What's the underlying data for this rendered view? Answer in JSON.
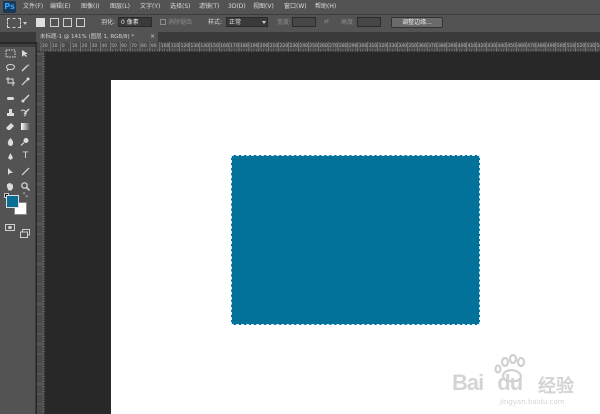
{
  "app": {
    "logo": "Ps"
  },
  "menu": [
    {
      "label": "文件(F)"
    },
    {
      "label": "编辑(E)"
    },
    {
      "label": "图像(I)"
    },
    {
      "label": "图层(L)"
    },
    {
      "label": "文字(Y)"
    },
    {
      "label": "选择(S)"
    },
    {
      "label": "滤镜(T)"
    },
    {
      "label": "3D(D)"
    },
    {
      "label": "视图(V)"
    },
    {
      "label": "窗口(W)"
    },
    {
      "label": "帮助(H)"
    }
  ],
  "options": {
    "feather_label": "羽化:",
    "feather_value": "0 像素",
    "antialias_label": "消除锯齿",
    "style_label": "样式:",
    "style_value": "正常",
    "width_label": "宽度:",
    "height_label": "高度:",
    "refine_edge": "调整边缘..."
  },
  "document_tab": {
    "title": "未标题-1 @ 141% (图层 1, RGB/8) *",
    "close": "×"
  },
  "ruler": {
    "top_ticks": [
      "20",
      "10",
      "0",
      "10",
      "20",
      "30",
      "40",
      "50",
      "60",
      "70",
      "80",
      "90",
      "100",
      "110",
      "120",
      "130",
      "140",
      "150",
      "160",
      "170",
      "180",
      "190",
      "200",
      "210",
      "220",
      "230",
      "240",
      "250",
      "260",
      "270",
      "280",
      "290",
      "300",
      "310",
      "320",
      "330",
      "340",
      "350",
      "360",
      "370",
      "380",
      "390",
      "400",
      "410",
      "420",
      "430",
      "440",
      "450",
      "460",
      "470",
      "480",
      "490",
      "500",
      "510",
      "520",
      "530",
      "540"
    ]
  },
  "colors": {
    "foreground": "#0a6f96",
    "background": "#ffffff",
    "shape_fill": "#03729a"
  },
  "tools": [
    "marquee-icon",
    "move-icon",
    "lasso-icon",
    "magic-wand-icon",
    "crop-icon",
    "eyedropper-icon",
    "healing-brush-icon",
    "brush-icon",
    "clone-stamp-icon",
    "history-brush-icon",
    "eraser-icon",
    "gradient-icon",
    "blur-icon",
    "dodge-icon",
    "pen-icon",
    "type-icon",
    "path-selection-icon",
    "line-icon",
    "hand-icon",
    "zoom-icon"
  ],
  "watermark": {
    "brand": "Bai",
    "brand2": "du",
    "product": "经验",
    "url": "jingyan.baidu.com"
  }
}
